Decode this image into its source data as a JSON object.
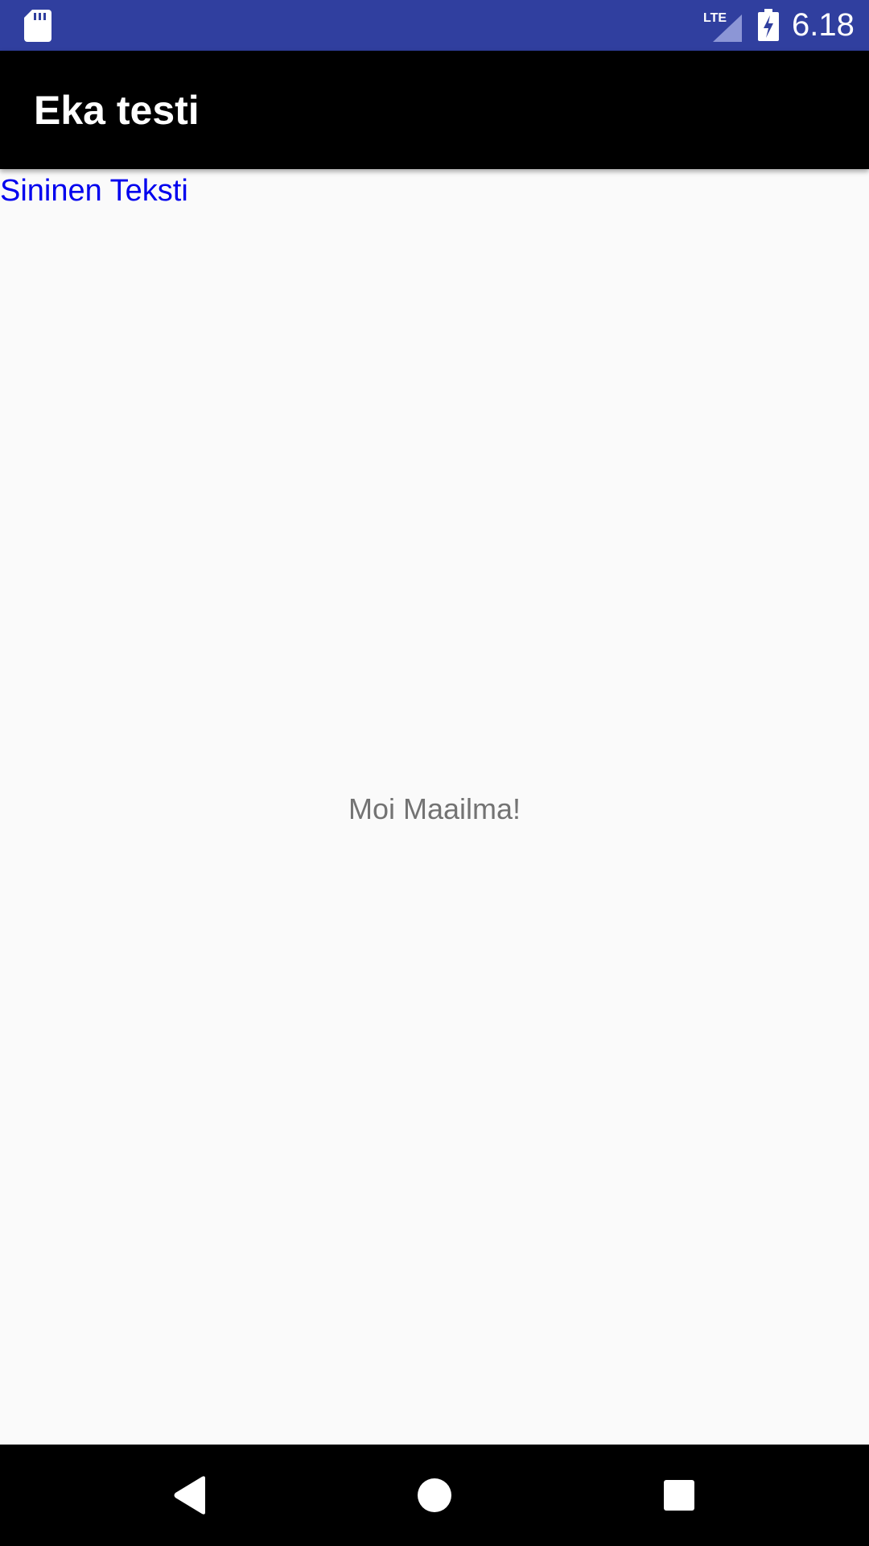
{
  "status_bar": {
    "clock": "6.18",
    "network_label": "LTE",
    "icons": [
      "sd-card-icon",
      "lte-signal-icon",
      "battery-charging-icon"
    ],
    "background_color": "#303f9f"
  },
  "app_bar": {
    "title": "Eka testi",
    "background_color": "#000000"
  },
  "content": {
    "blue_text": "Sininen Teksti",
    "blue_text_color": "#0000ee",
    "center_text": "Moi Maailma!",
    "center_text_color": "#737373",
    "background_color": "#fafafa"
  },
  "nav_bar": {
    "buttons": [
      "back-icon",
      "home-icon",
      "recents-icon"
    ],
    "background_color": "#000000"
  }
}
